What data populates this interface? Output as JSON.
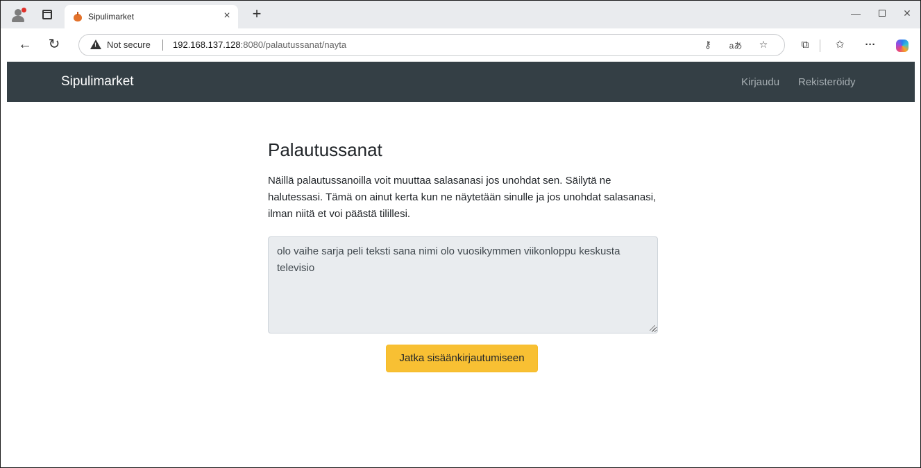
{
  "browser": {
    "tab_title": "Sipulimarket",
    "tab_close": "×",
    "new_tab": "+",
    "security_label": "Not secure",
    "url_host": "192.168.137.128",
    "url_rest": ":8080/palautussanat/nayta",
    "read_aloud_icon_text": "aあ",
    "window_controls": {
      "minimize": "—",
      "close": "✕"
    }
  },
  "navbar": {
    "brand": "Sipulimarket",
    "links": {
      "login": "Kirjaudu",
      "register": "Rekisteröidy"
    }
  },
  "main": {
    "title": "Palautussanat",
    "description": "Näillä palautussanoilla voit muuttaa salasanasi jos unohdat sen. Säilytä ne halutessasi. Tämä on ainut kerta kun ne näytetään sinulle ja jos unohdat salasanasi, ilman niitä et voi päästä tilillesi.",
    "recovery_words": "olo vaihe sarja peli teksti sana nimi olo vuosikymmen viikonloppu keskusta televisio",
    "continue_button": "Jatka sisäänkirjautumiseen"
  },
  "colors": {
    "navbar_bg": "#343f45",
    "button_bg": "#f8c033",
    "textarea_bg": "#e9ecef"
  }
}
